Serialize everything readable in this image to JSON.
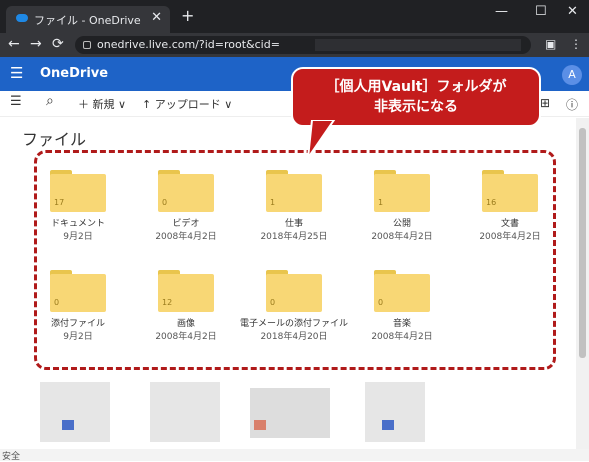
{
  "browser": {
    "tab_title": "ファイル - OneDrive",
    "tab_close": "✕",
    "new_tab": "+",
    "min": "—",
    "max": "☐",
    "close": "✕",
    "back": "←",
    "forward": "→",
    "reload": "⟳",
    "url": "onedrive.live.com/?id=root&cid=",
    "ext1": "▣",
    "menu": "⋮"
  },
  "app": {
    "waffle": "☰",
    "brand": "OneDrive",
    "avatar": "A"
  },
  "commands": {
    "menu": "☰",
    "search": "⌕",
    "new_label": "＋ 新規 ∨",
    "upload_label": "↑ アップロード ∨",
    "view": "⊞",
    "info": "ⓘ"
  },
  "heading": "ファイル",
  "callout": {
    "line1": "［個人用Vault］フォルダが",
    "line2": "非表示になる"
  },
  "folders": [
    {
      "name": "ドキュメント",
      "date": "9月2日",
      "count": "17"
    },
    {
      "name": "ビデオ",
      "date": "2008年4月2日",
      "count": "0"
    },
    {
      "name": "仕事",
      "date": "2018年4月25日",
      "count": "1"
    },
    {
      "name": "公開",
      "date": "2008年4月2日",
      "count": "1"
    },
    {
      "name": "文書",
      "date": "2008年4月2日",
      "count": "16"
    },
    {
      "name": "添付ファイル",
      "date": "9月2日",
      "count": "0"
    },
    {
      "name": "画像",
      "date": "2008年4月2日",
      "count": "12"
    },
    {
      "name": "電子メールの添付ファイル",
      "date": "2018年4月20日",
      "count": "0"
    },
    {
      "name": "音楽",
      "date": "2008年4月2日",
      "count": "0"
    }
  ],
  "status_text": "安全"
}
